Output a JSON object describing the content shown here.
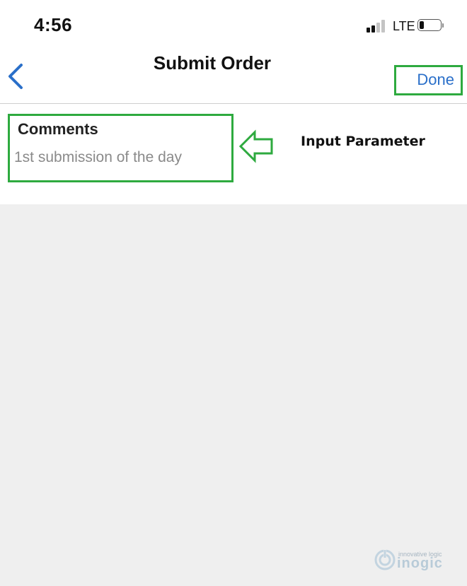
{
  "status_bar": {
    "time": "4:56",
    "network": "LTE",
    "signal_bars_filled": 2,
    "signal_bars_total": 4,
    "battery_level": 0.15
  },
  "nav": {
    "title": "Submit Order",
    "back_icon": "chevron-left-icon",
    "done_label": "Done"
  },
  "form": {
    "comments_label": "Comments",
    "comments_value": "1st submission of the day"
  },
  "annotation": {
    "arrow_icon": "hollow-left-arrow-icon",
    "label": "Input Parameter"
  },
  "watermark": {
    "tagline": "innovative logic",
    "brand": "inogic"
  },
  "colors": {
    "highlight_green": "#2eaa3f",
    "ios_blue": "#2a6fc9",
    "background_gray": "#efefef",
    "placeholder_gray": "#8a8a8a"
  }
}
